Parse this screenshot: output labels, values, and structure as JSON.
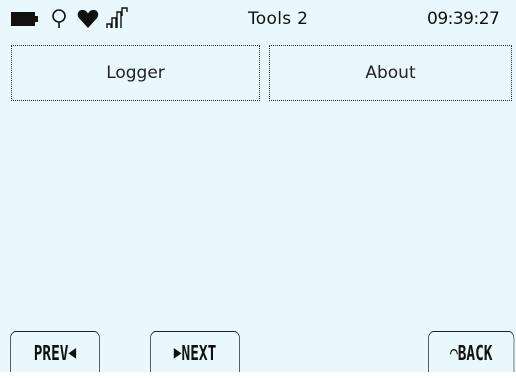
{
  "status_bar": {
    "icons": [
      "battery-icon",
      "lightbulb-icon",
      "heart-icon",
      "signal-icon"
    ],
    "title": "Tools 2",
    "time": "09:39:27"
  },
  "menu": {
    "items": [
      {
        "label": "Logger"
      },
      {
        "label": "About"
      }
    ]
  },
  "footer": {
    "prev_label": "PREV",
    "prev_glyph": "◀",
    "next_label": "NEXT",
    "next_glyph": "▶",
    "back_label": "BACK",
    "back_glyph": "⌒"
  }
}
